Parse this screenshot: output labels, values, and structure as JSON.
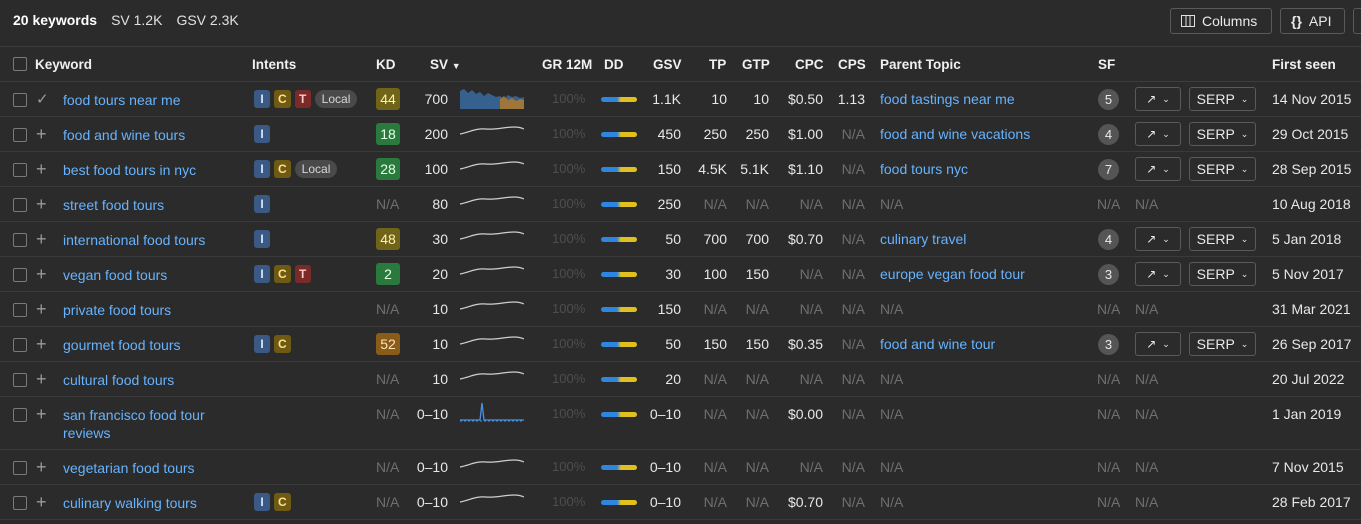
{
  "summary": {
    "keywords": "20 keywords",
    "sv": "SV 1.2K",
    "gsv": "GSV 2.3K"
  },
  "toolbar": {
    "columns_label": "Columns",
    "api_label": "API",
    "columns_icon": "columns-icon",
    "api_icon": "braces-icon"
  },
  "headers": {
    "keyword": "Keyword",
    "intents": "Intents",
    "kd": "KD",
    "sv": "SV",
    "gr12m": "GR 12M",
    "dd": "DD",
    "gsv": "GSV",
    "tp": "TP",
    "gtp": "GTP",
    "cpc": "CPC",
    "cps": "CPS",
    "parent_topic": "Parent Topic",
    "sf": "SF",
    "first_seen": "First seen"
  },
  "colors": {
    "link": "#66b3ff",
    "kd_green": "#2a7a3e",
    "kd_olive": "#6f6418",
    "kd_amber": "#8a5c1a",
    "dd_blue": "#2f86e0",
    "dd_yellow": "#e0c020"
  },
  "rows": [
    {
      "keyword": "food tours near me",
      "added": true,
      "intents": [
        "I",
        "C",
        "T",
        "Local"
      ],
      "kd": "44",
      "kd_tone": "olive",
      "sv": "700",
      "trend": "area",
      "gr": "100%",
      "gsv": "1.1K",
      "tp": "10",
      "gtp": "10",
      "cpc": "$0.50",
      "cps": "1.13",
      "parent": "food tastings near me",
      "sf": "5",
      "serp": "SERP",
      "first_seen": "14 Nov 2015"
    },
    {
      "keyword": "food and wine tours",
      "added": false,
      "intents": [
        "I"
      ],
      "kd": "18",
      "kd_tone": "green",
      "sv": "200",
      "trend": "wave",
      "gr": "100%",
      "gsv": "450",
      "tp": "250",
      "gtp": "250",
      "cpc": "$1.00",
      "cps": "N/A",
      "parent": "food and wine vacations",
      "sf": "4",
      "serp": "SERP",
      "first_seen": "29 Oct 2015"
    },
    {
      "keyword": "best food tours in nyc",
      "added": false,
      "intents": [
        "I",
        "C",
        "Local"
      ],
      "kd": "28",
      "kd_tone": "green",
      "sv": "100",
      "trend": "wave",
      "gr": "100%",
      "gsv": "150",
      "tp": "4.5K",
      "gtp": "5.1K",
      "cpc": "$1.10",
      "cps": "N/A",
      "parent": "food tours nyc",
      "sf": "7",
      "serp": "SERP",
      "first_seen": "28 Sep 2015"
    },
    {
      "keyword": "street food tours",
      "added": false,
      "intents": [
        "I"
      ],
      "kd": "N/A",
      "kd_tone": "",
      "sv": "80",
      "trend": "wave",
      "gr": "100%",
      "gsv": "250",
      "tp": "N/A",
      "gtp": "N/A",
      "cpc": "N/A",
      "cps": "N/A",
      "parent": "N/A",
      "sf": "N/A",
      "serp": "N/A",
      "first_seen": "10 Aug 2018"
    },
    {
      "keyword": "international food tours",
      "added": false,
      "intents": [
        "I"
      ],
      "kd": "48",
      "kd_tone": "olive",
      "sv": "30",
      "trend": "wave",
      "gr": "100%",
      "gsv": "50",
      "tp": "700",
      "gtp": "700",
      "cpc": "$0.70",
      "cps": "N/A",
      "parent": "culinary travel",
      "sf": "4",
      "serp": "SERP",
      "first_seen": "5 Jan 2018"
    },
    {
      "keyword": "vegan food tours",
      "added": false,
      "intents": [
        "I",
        "C",
        "T"
      ],
      "kd": "2",
      "kd_tone": "green",
      "sv": "20",
      "trend": "wave",
      "gr": "100%",
      "gsv": "30",
      "tp": "100",
      "gtp": "150",
      "cpc": "N/A",
      "cps": "N/A",
      "parent": "europe vegan food tour",
      "sf": "3",
      "serp": "SERP",
      "first_seen": "5 Nov 2017"
    },
    {
      "keyword": "private food tours",
      "added": false,
      "intents": [],
      "kd": "N/A",
      "kd_tone": "",
      "sv": "10",
      "trend": "wave",
      "gr": "100%",
      "gsv": "150",
      "tp": "N/A",
      "gtp": "N/A",
      "cpc": "N/A",
      "cps": "N/A",
      "parent": "N/A",
      "sf": "N/A",
      "serp": "N/A",
      "first_seen": "31 Mar 2021"
    },
    {
      "keyword": "gourmet food tours",
      "added": false,
      "intents": [
        "I",
        "C"
      ],
      "kd": "52",
      "kd_tone": "amber",
      "sv": "10",
      "trend": "wave",
      "gr": "100%",
      "gsv": "50",
      "tp": "150",
      "gtp": "150",
      "cpc": "$0.35",
      "cps": "N/A",
      "parent": "food and wine tour",
      "sf": "3",
      "serp": "SERP",
      "first_seen": "26 Sep 2017"
    },
    {
      "keyword": "cultural food tours",
      "added": false,
      "intents": [],
      "kd": "N/A",
      "kd_tone": "",
      "sv": "10",
      "trend": "wave",
      "gr": "100%",
      "gsv": "20",
      "tp": "N/A",
      "gtp": "N/A",
      "cpc": "N/A",
      "cps": "N/A",
      "parent": "N/A",
      "sf": "N/A",
      "serp": "N/A",
      "first_seen": "20 Jul 2022"
    },
    {
      "keyword": "san francisco food tour reviews",
      "keyword_line1": "san francisco food tour",
      "keyword_line2": "reviews",
      "added": false,
      "intents": [],
      "kd": "N/A",
      "kd_tone": "",
      "sv": "0–10",
      "trend": "spike",
      "gr": "100%",
      "gsv": "0–10",
      "tp": "N/A",
      "gtp": "N/A",
      "cpc": "$0.00",
      "cps": "N/A",
      "parent": "N/A",
      "sf": "N/A",
      "serp": "N/A",
      "first_seen": "1 Jan 2019"
    },
    {
      "keyword": "vegetarian food tours",
      "added": false,
      "intents": [],
      "kd": "N/A",
      "kd_tone": "",
      "sv": "0–10",
      "trend": "wave",
      "gr": "100%",
      "gsv": "0–10",
      "tp": "N/A",
      "gtp": "N/A",
      "cpc": "N/A",
      "cps": "N/A",
      "parent": "N/A",
      "sf": "N/A",
      "serp": "N/A",
      "first_seen": "7 Nov 2015"
    },
    {
      "keyword": "culinary walking tours",
      "added": false,
      "intents": [
        "I",
        "C"
      ],
      "kd": "N/A",
      "kd_tone": "",
      "sv": "0–10",
      "trend": "wave",
      "gr": "100%",
      "gsv": "0–10",
      "tp": "N/A",
      "gtp": "N/A",
      "cpc": "$0.70",
      "cps": "N/A",
      "parent": "N/A",
      "sf": "N/A",
      "serp": "N/A",
      "first_seen": "28 Feb 2017"
    }
  ]
}
